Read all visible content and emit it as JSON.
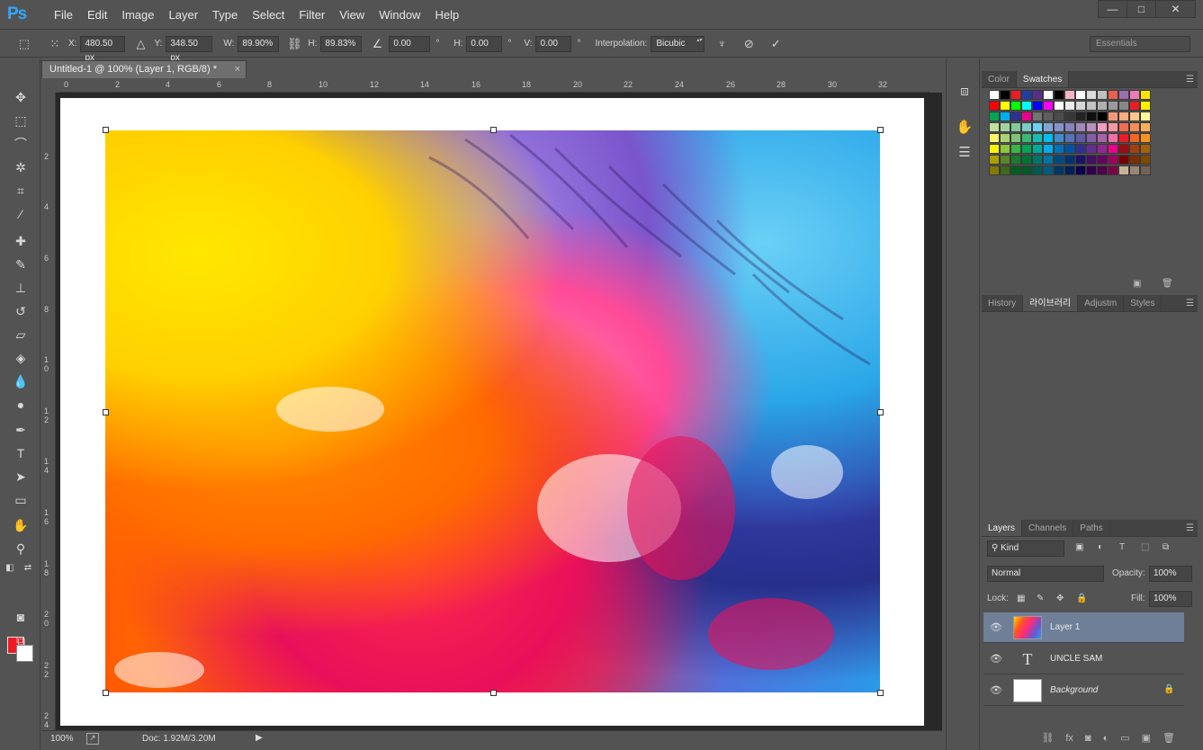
{
  "app": {
    "logo": "Ps"
  },
  "menu": [
    "File",
    "Edit",
    "Image",
    "Layer",
    "Type",
    "Select",
    "Filter",
    "View",
    "Window",
    "Help"
  ],
  "options": {
    "x_label": "X:",
    "x_value": "480.50 px",
    "y_label": "Y:",
    "y_value": "348.50 px",
    "w_label": "W:",
    "w_value": "89.90%",
    "h_label": "H:",
    "h_value": "89.83%",
    "angle_value": "0.00",
    "degree": "°",
    "hskew_label": "H:",
    "hskew_value": "0.00",
    "vskew_label": "V:",
    "vskew_value": "0.00",
    "interp_label": "Interpolation:",
    "interp_value": "Bicubic"
  },
  "workspace": "Essentials",
  "window_controls": {
    "minimize": "—",
    "maximize": "□",
    "close": "✕"
  },
  "document": {
    "tab_title": "Untitled-1 @ 100% (Layer 1, RGB/8) *",
    "tab_close": "×"
  },
  "ruler_h": [
    "0",
    "2",
    "4",
    "6",
    "8",
    "10",
    "12",
    "14",
    "16",
    "18",
    "20",
    "22",
    "24",
    "26",
    "28",
    "30",
    "32"
  ],
  "ruler_v": [
    "2",
    "4",
    "6",
    "8",
    "10",
    "12",
    "14",
    "16",
    "18",
    "20",
    "22",
    "24"
  ],
  "status": {
    "zoom": "100%",
    "doc": "Doc: 1.92M/3.20M"
  },
  "color_panel": {
    "tabs": [
      "Color",
      "Swatches"
    ],
    "active": "Swatches"
  },
  "history_panel": {
    "tabs": [
      "History",
      "라이브러리",
      "Adjustm",
      "Styles"
    ],
    "active": "라이브러리"
  },
  "swatch_colors": [
    [
      "#ffffff",
      "#000000",
      "#ed1c24",
      "#1f3ea0",
      "#5a2d8a",
      "#ffffff",
      "#000000",
      "#f7b3c2",
      "#ffffff",
      "#dcdcdc",
      "#c0c0c0",
      "#e8624a",
      "#9a6fb0",
      "#f17ab5",
      "#f5e400"
    ],
    [
      "#ff0000",
      "#ffff00",
      "#00ff00",
      "#00ffff",
      "#0000ff",
      "#ff00ff",
      "#ffffff",
      "#ebebeb",
      "#d7d7d7",
      "#c3c3c3",
      "#afafaf",
      "#9b9b9b",
      "#878787",
      "#ed1c24",
      "#ffef00"
    ],
    [
      "#00a651",
      "#00aeef",
      "#2e3192",
      "#ec008c",
      "#737373",
      "#5f5f5f",
      "#4b4b4b",
      "#373737",
      "#232323",
      "#0f0f0f",
      "#000000",
      "#f7977a",
      "#f9ad81",
      "#fdc68a",
      "#fff79a"
    ],
    [
      "#c4df9b",
      "#a3d39c",
      "#82ca9d",
      "#7bcdc8",
      "#6ecff6",
      "#7ea7d8",
      "#8493ca",
      "#8882be",
      "#a187be",
      "#bc8dbf",
      "#f49ac2",
      "#f6989d",
      "#f26c4f",
      "#f68e56",
      "#fbaf5d"
    ],
    [
      "#fff467",
      "#acd373",
      "#7cc576",
      "#3bb878",
      "#1abbb4",
      "#00bff3",
      "#438ccb",
      "#5574b9",
      "#605ca8",
      "#855fa8",
      "#a763a8",
      "#f06ea9",
      "#ed1c24",
      "#f26522",
      "#f7941d"
    ],
    [
      "#fff200",
      "#8dc63f",
      "#39b54a",
      "#00a651",
      "#00a99d",
      "#00aeef",
      "#0072bc",
      "#0054a6",
      "#2e3192",
      "#662d91",
      "#92278f",
      "#ec008c",
      "#9e0b0f",
      "#a0410d",
      "#a36209"
    ],
    [
      "#aba000",
      "#598527",
      "#197b30",
      "#007236",
      "#00746b",
      "#0076a3",
      "#004a80",
      "#003471",
      "#1b1464",
      "#440e62",
      "#630460",
      "#9e005d",
      "#790000",
      "#7b2e00",
      "#7d4900"
    ],
    [
      "#827b00",
      "#406618",
      "#005e20",
      "#005826",
      "#005952",
      "#005b7f",
      "#003663",
      "#002157",
      "#0d004c",
      "#32004b",
      "#4b0049",
      "#7b0046",
      "#c7b299",
      "#998675",
      "#736357"
    ]
  ],
  "layers_panel": {
    "tabs": [
      "Layers",
      "Channels",
      "Paths"
    ],
    "active": "Layers",
    "kind": "Kind",
    "blend": "Normal",
    "opacity_label": "Opacity:",
    "opacity": "100%",
    "lock_label": "Lock:",
    "fill_label": "Fill:",
    "fill": "100%",
    "layers": [
      {
        "name": "Layer 1",
        "selected": true
      },
      {
        "name": "UNCLE SAM",
        "type": "text"
      },
      {
        "name": "Background",
        "locked": true
      }
    ]
  },
  "colors": {
    "accent": "#31a8ff",
    "foreground": "#ed1c24",
    "background": "#ffffff",
    "selection": "#6f7f98"
  }
}
